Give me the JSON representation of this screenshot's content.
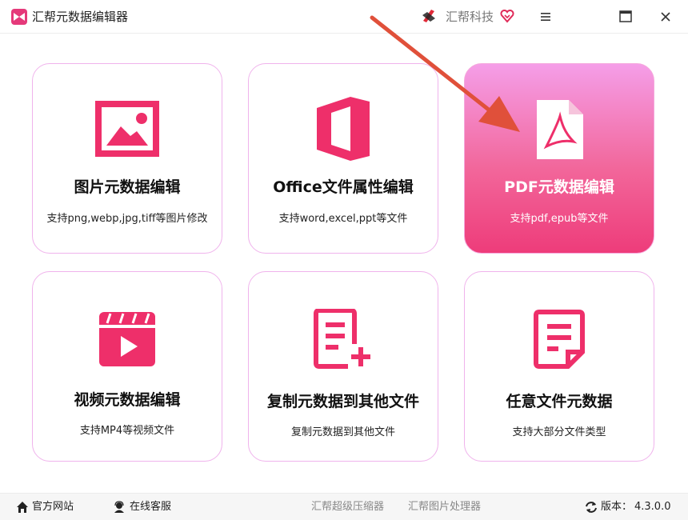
{
  "window": {
    "title": "汇帮元数据编辑器",
    "brand_name": "汇帮科技"
  },
  "cards": [
    {
      "title": "图片元数据编辑",
      "subtitle": "支持png,webp,jpg,tiff等图片修改",
      "icon": "image-icon"
    },
    {
      "title": "Office文件属性编辑",
      "subtitle": "支持word,excel,ppt等文件",
      "icon": "office-icon"
    },
    {
      "title": "PDF元数据编辑",
      "subtitle": "支持pdf,epub等文件",
      "icon": "pdf-icon",
      "active": true
    },
    {
      "title": "视频元数据编辑",
      "subtitle": "支持MP4等视频文件",
      "icon": "video-icon"
    },
    {
      "title": "复制元数据到其他文件",
      "subtitle": "复制元数据到其他文件",
      "icon": "copy-doc-icon"
    },
    {
      "title": "任意文件元数据",
      "subtitle": "支持大部分文件类型",
      "icon": "any-file-icon"
    }
  ],
  "footer": {
    "website": "官方网站",
    "support": "在线客服",
    "compressor": "汇帮超级压缩器",
    "image_tool": "汇帮图片处理器",
    "version_label": "版本：",
    "version": "4.3.0.0"
  },
  "colors": {
    "accent": "#ee2f6a",
    "card_border": "#f0b3ec",
    "active_gradient_top": "#f59ee8",
    "active_gradient_bottom": "#ee3c7a"
  }
}
